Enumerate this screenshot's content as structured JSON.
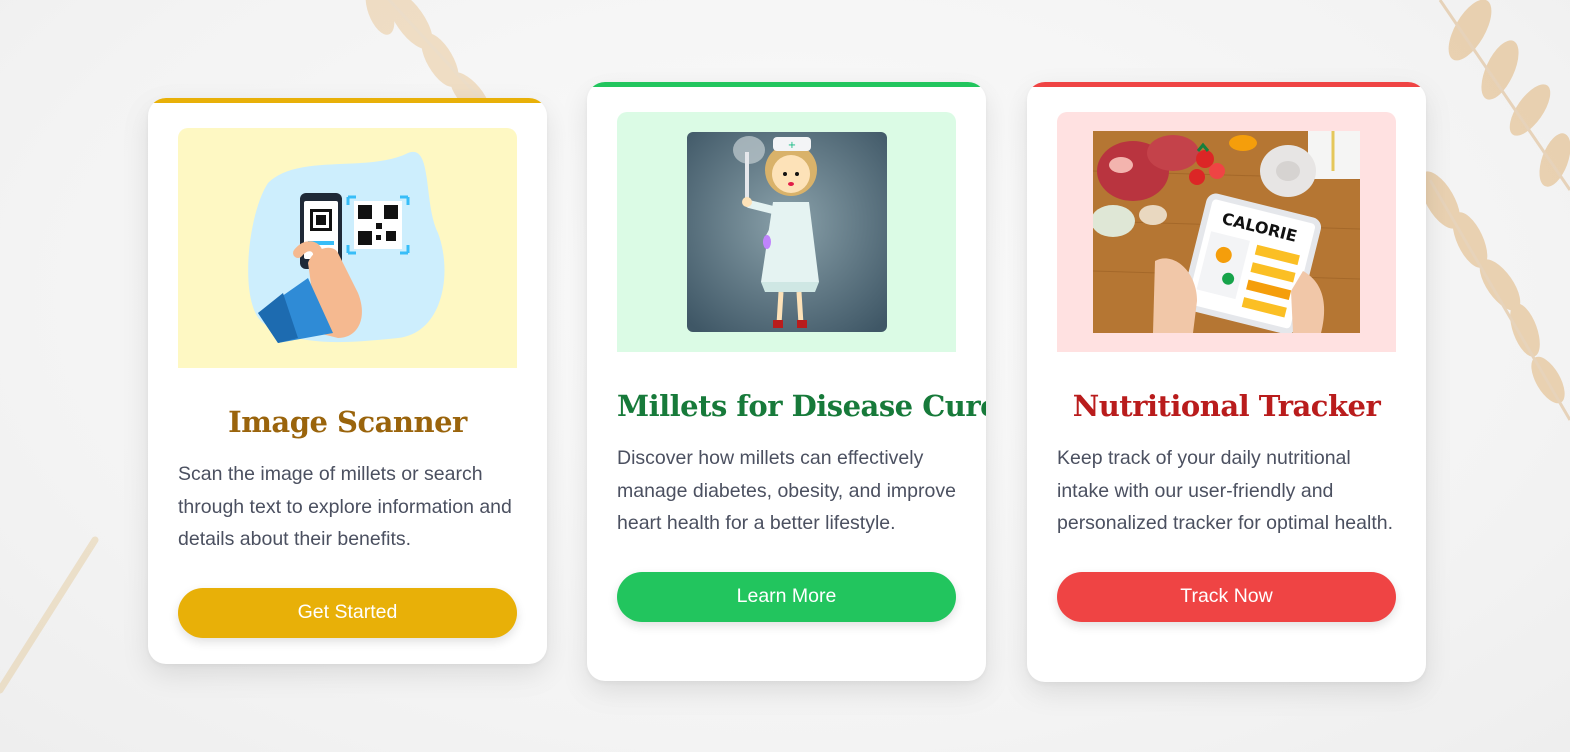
{
  "cards": [
    {
      "title": "Image Scanner",
      "description": "Scan the image of millets or search through text to explore information and details about their benefits.",
      "button_label": "Get Started",
      "accent_color": "#e8b008",
      "image": "qr-scanner-illustration"
    },
    {
      "title": "Millets for Disease Cure",
      "description": "Discover how millets can effectively manage diabetes, obesity, and improve heart health for a better lifestyle.",
      "button_label": "Learn More",
      "accent_color": "#22c55e",
      "image": "nurse-with-syringe-illustration"
    },
    {
      "title": "Nutritional Tracker",
      "description": "Keep track of your daily nutritional intake with our user-friendly and personalized tracker for optimal health.",
      "button_label": "Track Now",
      "accent_color": "#ef4444",
      "image": "calorie-counter-tablet-photo",
      "image_text": "CALORIE"
    }
  ]
}
